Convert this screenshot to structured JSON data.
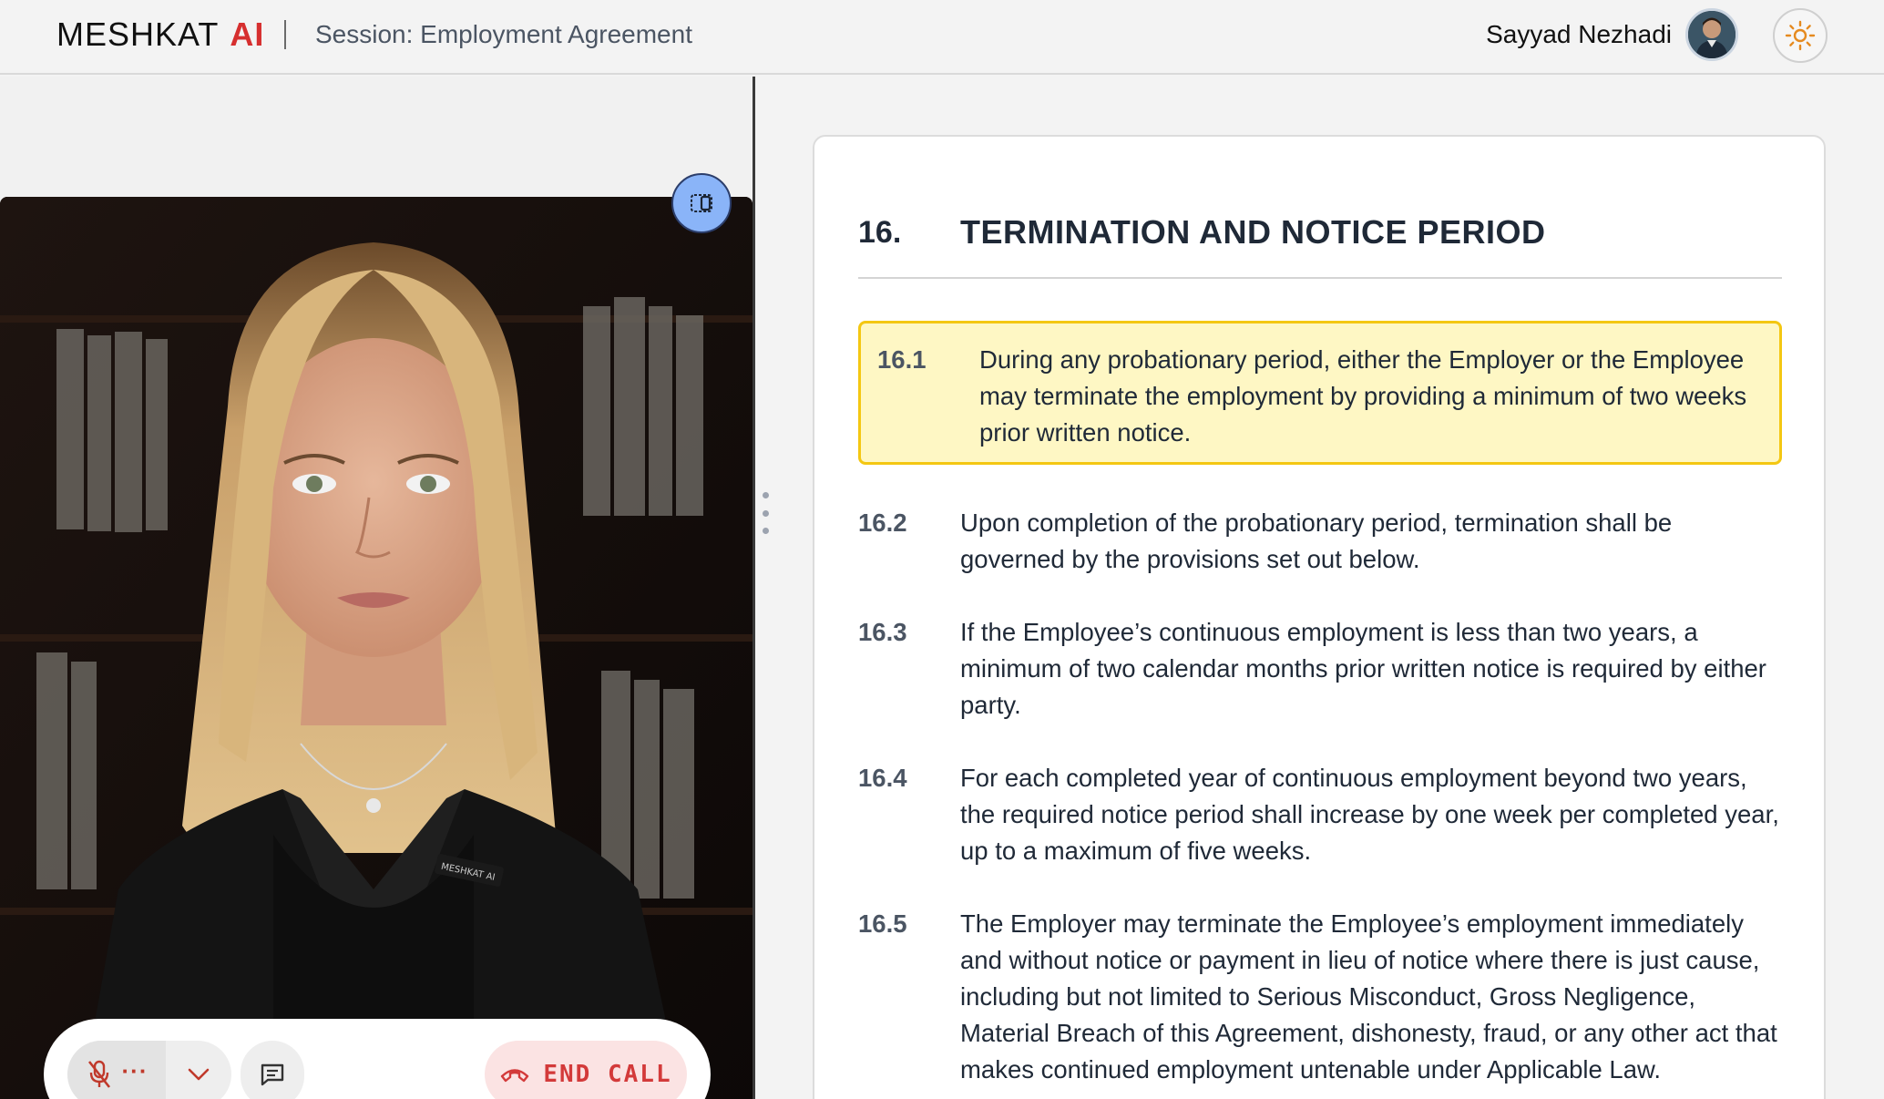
{
  "header": {
    "brand_name": "MESHKAT",
    "brand_accent": "AI",
    "session_label": "Session: Employment Agreement",
    "user_name": "Sayyad Nezhadi",
    "theme_icon": "sun-icon"
  },
  "call": {
    "pip_icon": "picture-in-picture-icon",
    "mic_icon": "mic-off-icon",
    "mic_more": "···",
    "chevron_icon": "chevron-down-icon",
    "chat_icon": "chat-icon",
    "end_call_label": "END CALL",
    "end_call_icon": "phone-hangup-icon",
    "badge_text": "MESHKAT AI"
  },
  "document": {
    "section_number": "16.",
    "section_title": "TERMINATION AND NOTICE PERIOD",
    "clauses": [
      {
        "number": "16.1",
        "text": "During any probationary period, either the Employer or the Employee may terminate the employment by providing a minimum of two weeks prior written notice.",
        "highlighted": true
      },
      {
        "number": "16.2",
        "text": "Upon completion of the probationary period, termination shall be governed by the provisions set out below."
      },
      {
        "number": "16.3",
        "text": "If the Employee’s continuous employment is less than two years, a minimum of two calendar months prior written notice is required by either party."
      },
      {
        "number": "16.4",
        "text": "For each completed year of continuous employment beyond two years, the required notice period shall increase by one week per completed year, up to a maximum of five weeks."
      },
      {
        "number": "16.5",
        "text": "The Employer may terminate the Employee’s employment immediately and without notice or payment in lieu of notice where there is just cause, including but not limited to Serious Misconduct, Gross Negligence, Material Breach of this Agreement, dishonesty, fraud, or any other act that makes continued employment untenable under Applicable Law."
      }
    ]
  },
  "colors": {
    "brand_accent": "#d62f2f",
    "highlight_bg": "#fef7c4",
    "highlight_border": "#f4c712",
    "end_call": "#d33a3a",
    "pip_button": "#8ab4f8"
  }
}
